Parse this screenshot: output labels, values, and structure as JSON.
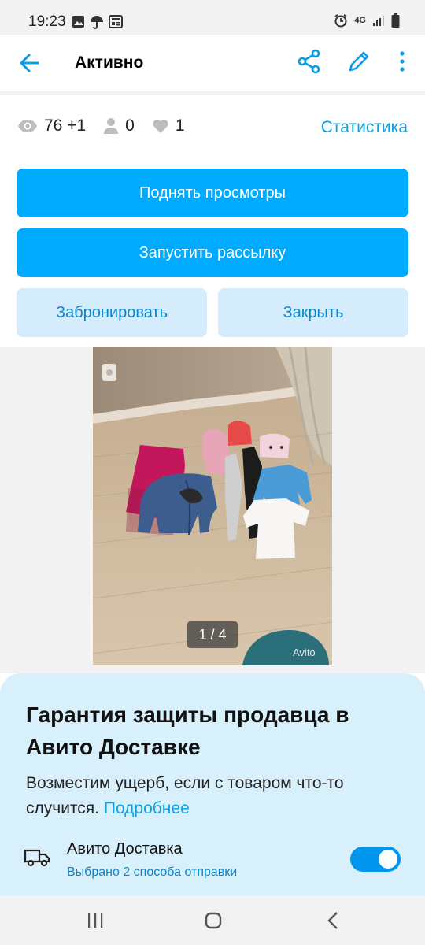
{
  "status_bar": {
    "time": "19:23",
    "network": "4G",
    "icons": [
      "image-icon",
      "umbrella-icon",
      "news-icon",
      "alarm-icon",
      "signal-icon",
      "battery-icon"
    ]
  },
  "header": {
    "title": "Активно",
    "icons": [
      "back-arrow-icon",
      "share-icon",
      "pencil-icon",
      "more-vert-icon"
    ]
  },
  "stats": {
    "views": "76 +1",
    "contacts": "0",
    "favorites": "1",
    "link": "Статистика"
  },
  "actions": {
    "raise_views": "Поднять просмотры",
    "start_mailing": "Запустить рассылку",
    "reserve": "Забронировать",
    "close": "Закрыть"
  },
  "gallery": {
    "counter": "1 / 4",
    "watermark": "Avito"
  },
  "promo": {
    "title": "Гарантия защиты продавца в Авито Доставке",
    "text": "Возместим ущерб, если с товаром что-то случится.",
    "link": "Подробнее"
  },
  "delivery": {
    "label": "Авито Доставка",
    "subtitle": "Выбрано 2 способа отправки",
    "toggle_on": true
  },
  "colors": {
    "accent": "#00aaff",
    "link": "#0ca2e6",
    "secondary_bg": "#d4ecfb",
    "promo_bg": "#d7f0fb"
  }
}
